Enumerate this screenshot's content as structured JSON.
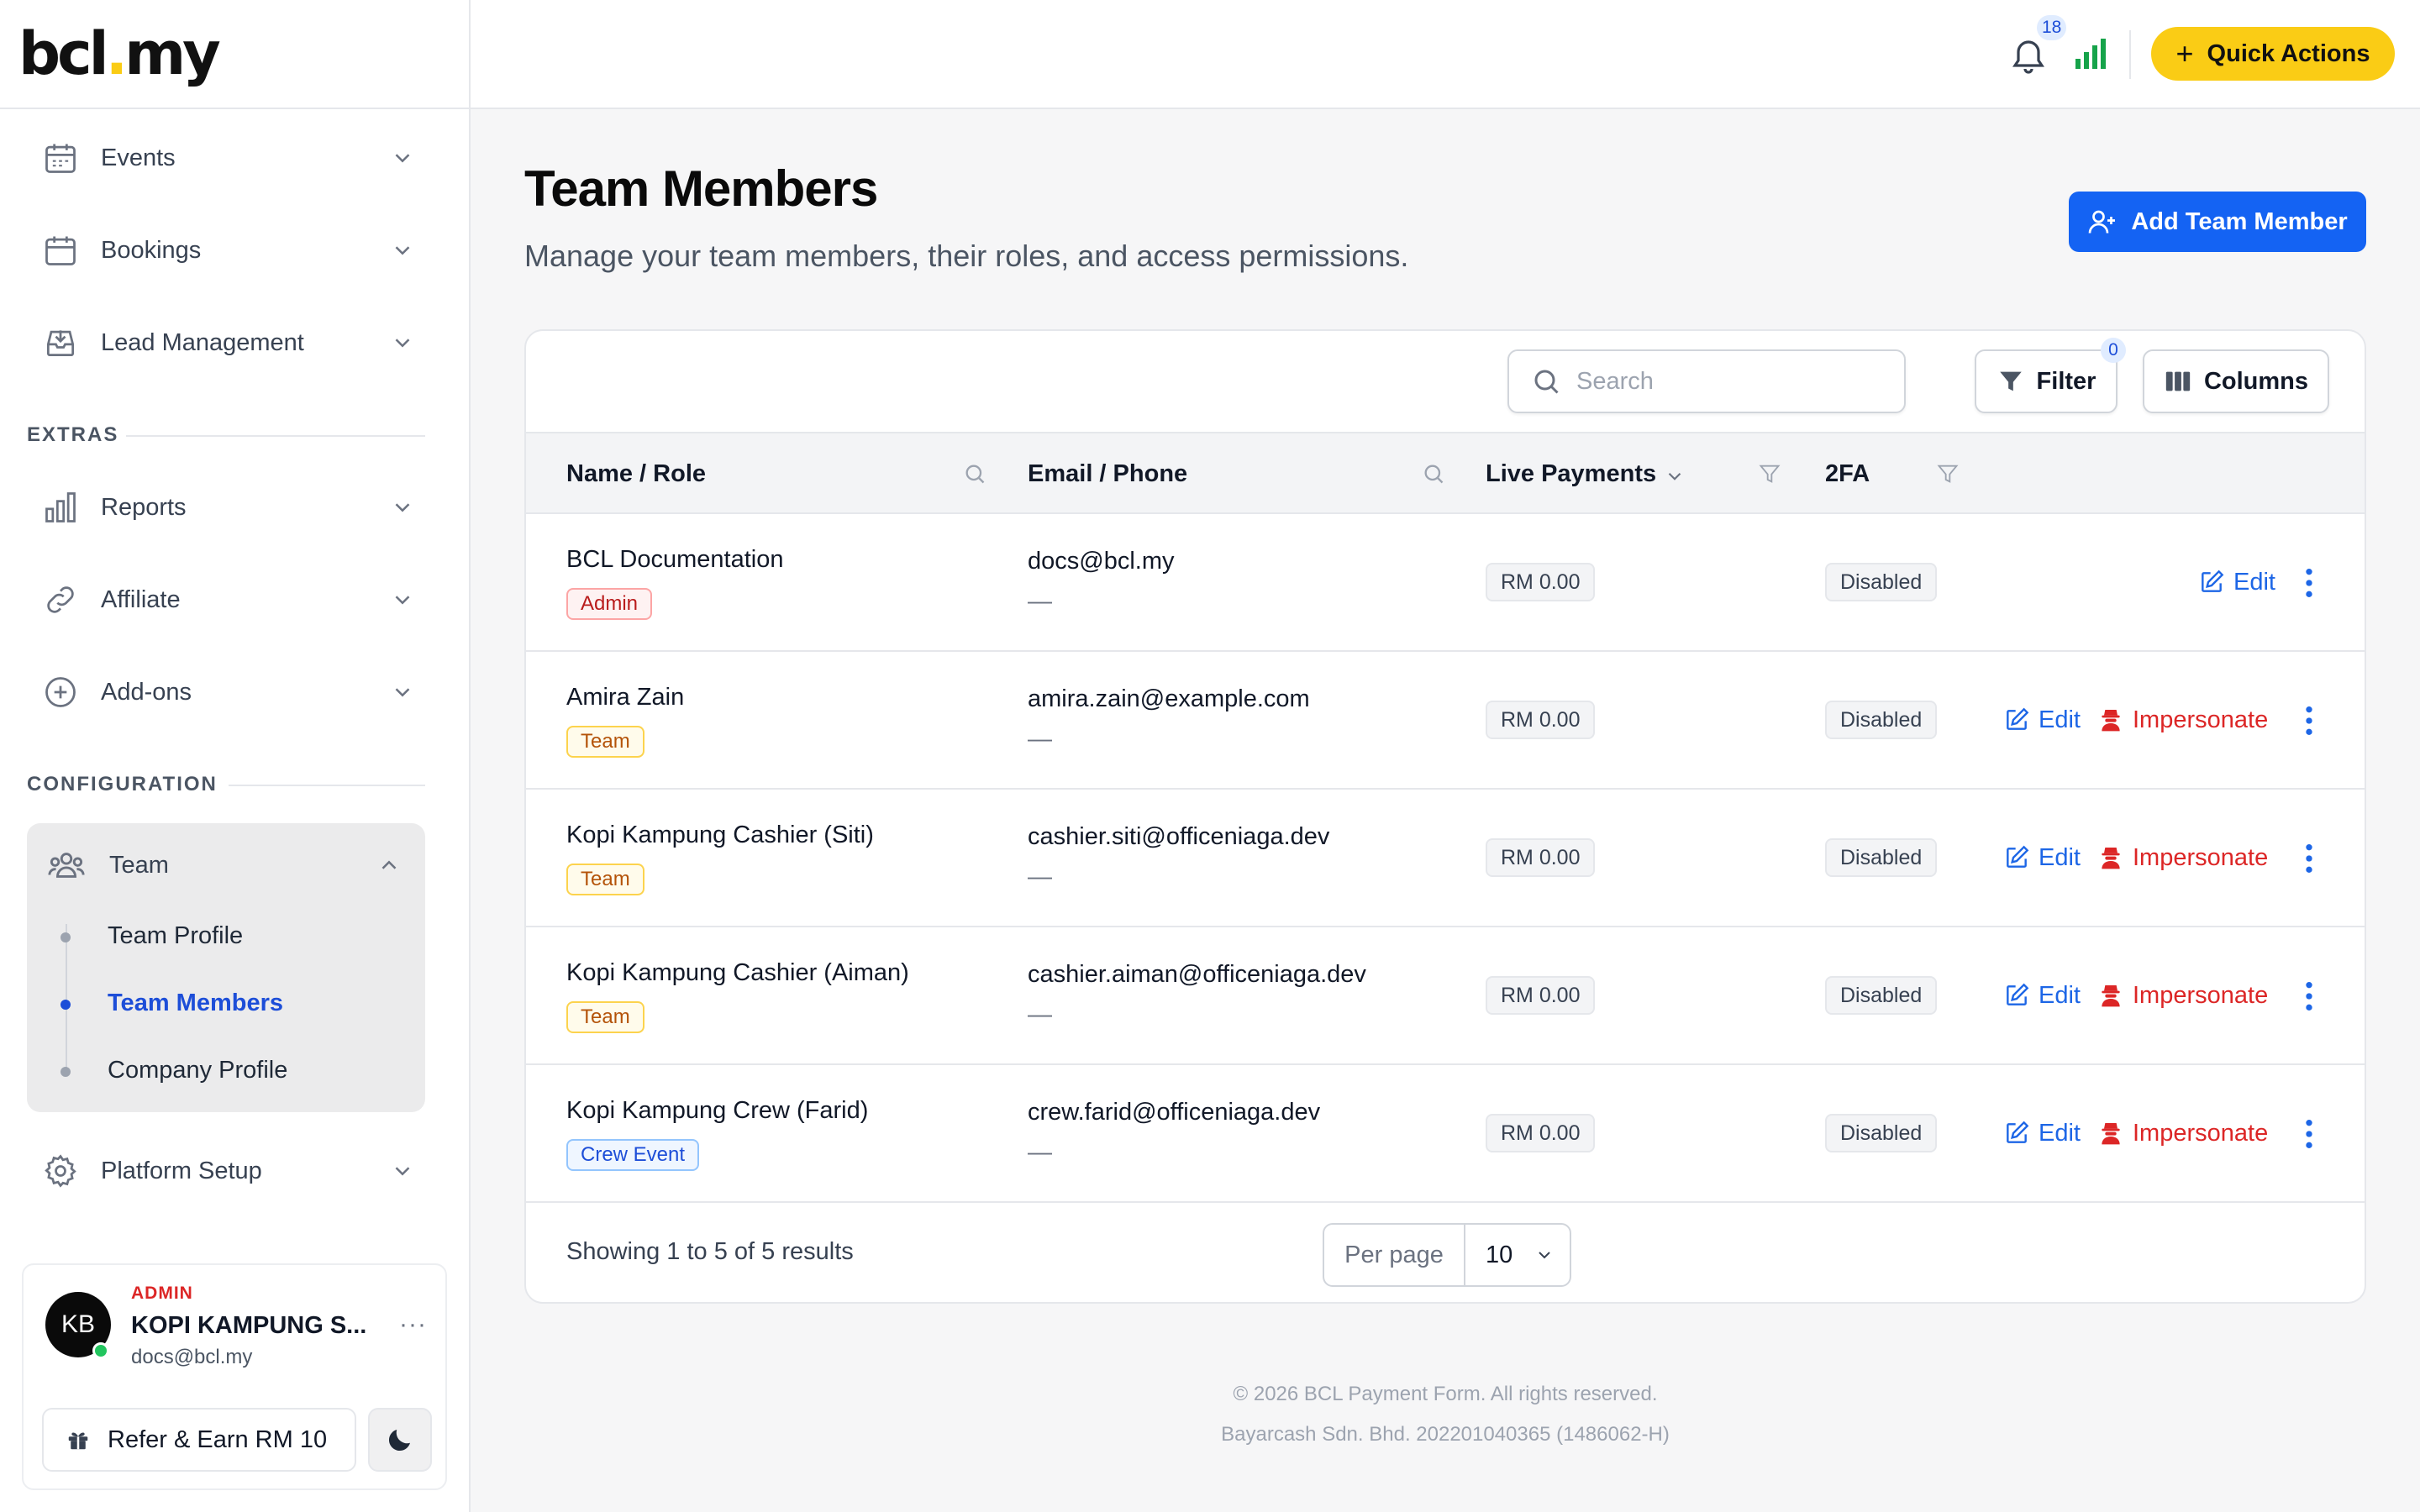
{
  "brand": {
    "logo_left": "bcl",
    "logo_dot": ".",
    "logo_right": "my"
  },
  "sidebar": {
    "items_top": [
      {
        "label": "Events",
        "icon": "calendar-icon"
      },
      {
        "label": "Bookings",
        "icon": "calendar-icon"
      },
      {
        "label": "Lead Management",
        "icon": "inbox-icon"
      }
    ],
    "extras_label": "EXTRAS",
    "items_extras": [
      {
        "label": "Reports",
        "icon": "bar-chart-icon"
      },
      {
        "label": "Affiliate",
        "icon": "link-icon"
      },
      {
        "label": "Add-ons",
        "icon": "plus-circle-icon"
      }
    ],
    "config_label": "CONFIGURATION",
    "team": {
      "label": "Team",
      "children": [
        "Team Profile",
        "Team Members",
        "Company Profile"
      ],
      "active": "Team Members"
    },
    "platform_setup": "Platform Setup",
    "user": {
      "initials": "KB",
      "role": "ADMIN",
      "org": "KOPI KAMPUNG S...",
      "email": "docs@bcl.my",
      "more": "···"
    },
    "refer_label": "Refer & Earn RM 10"
  },
  "topbar": {
    "notification_count": "18",
    "quick_actions_label": "Quick Actions",
    "quick_actions_plus": "+",
    "accent_color": "#facc15"
  },
  "page": {
    "title": "Team Members",
    "subtitle": "Manage your team members, their roles, and access permissions.",
    "add_button_label": "Add Team Member"
  },
  "toolbar": {
    "search_placeholder": "Search",
    "filter_label": "Filter",
    "filter_count": "0",
    "columns_label": "Columns"
  },
  "table": {
    "columns": [
      "Name / Role",
      "Email / Phone",
      "Live Payments",
      "2FA"
    ],
    "rows": [
      {
        "name": "BCL Documentation",
        "role": "Admin",
        "email": "docs@bcl.my",
        "phone": "—",
        "payments": "RM 0.00",
        "twofa": "Disabled",
        "edit": "Edit",
        "impersonate": ""
      },
      {
        "name": "Amira Zain",
        "role": "Team",
        "email": "amira.zain@example.com",
        "phone": "—",
        "payments": "RM 0.00",
        "twofa": "Disabled",
        "edit": "Edit",
        "impersonate": "Impersonate"
      },
      {
        "name": "Kopi Kampung Cashier (Siti)",
        "role": "Team",
        "email": "cashier.siti@officeniaga.dev",
        "phone": "—",
        "payments": "RM 0.00",
        "twofa": "Disabled",
        "edit": "Edit",
        "impersonate": "Impersonate"
      },
      {
        "name": "Kopi Kampung Cashier (Aiman)",
        "role": "Team",
        "email": "cashier.aiman@officeniaga.dev",
        "phone": "—",
        "payments": "RM 0.00",
        "twofa": "Disabled",
        "edit": "Edit",
        "impersonate": "Impersonate"
      },
      {
        "name": "Kopi Kampung Crew (Farid)",
        "role": "Crew Event",
        "email": "crew.farid@officeniaga.dev",
        "phone": "—",
        "payments": "RM 0.00",
        "twofa": "Disabled",
        "edit": "Edit",
        "impersonate": "Impersonate"
      }
    ],
    "summary": "Showing 1 to 5 of 5 results",
    "per_page_label": "Per page",
    "per_page_value": "10"
  },
  "footer": {
    "copyright": "© 2026 BCL Payment Form. All rights reserved.",
    "company": "Bayarcash Sdn. Bhd. 202201040365 (1486062-H)"
  }
}
